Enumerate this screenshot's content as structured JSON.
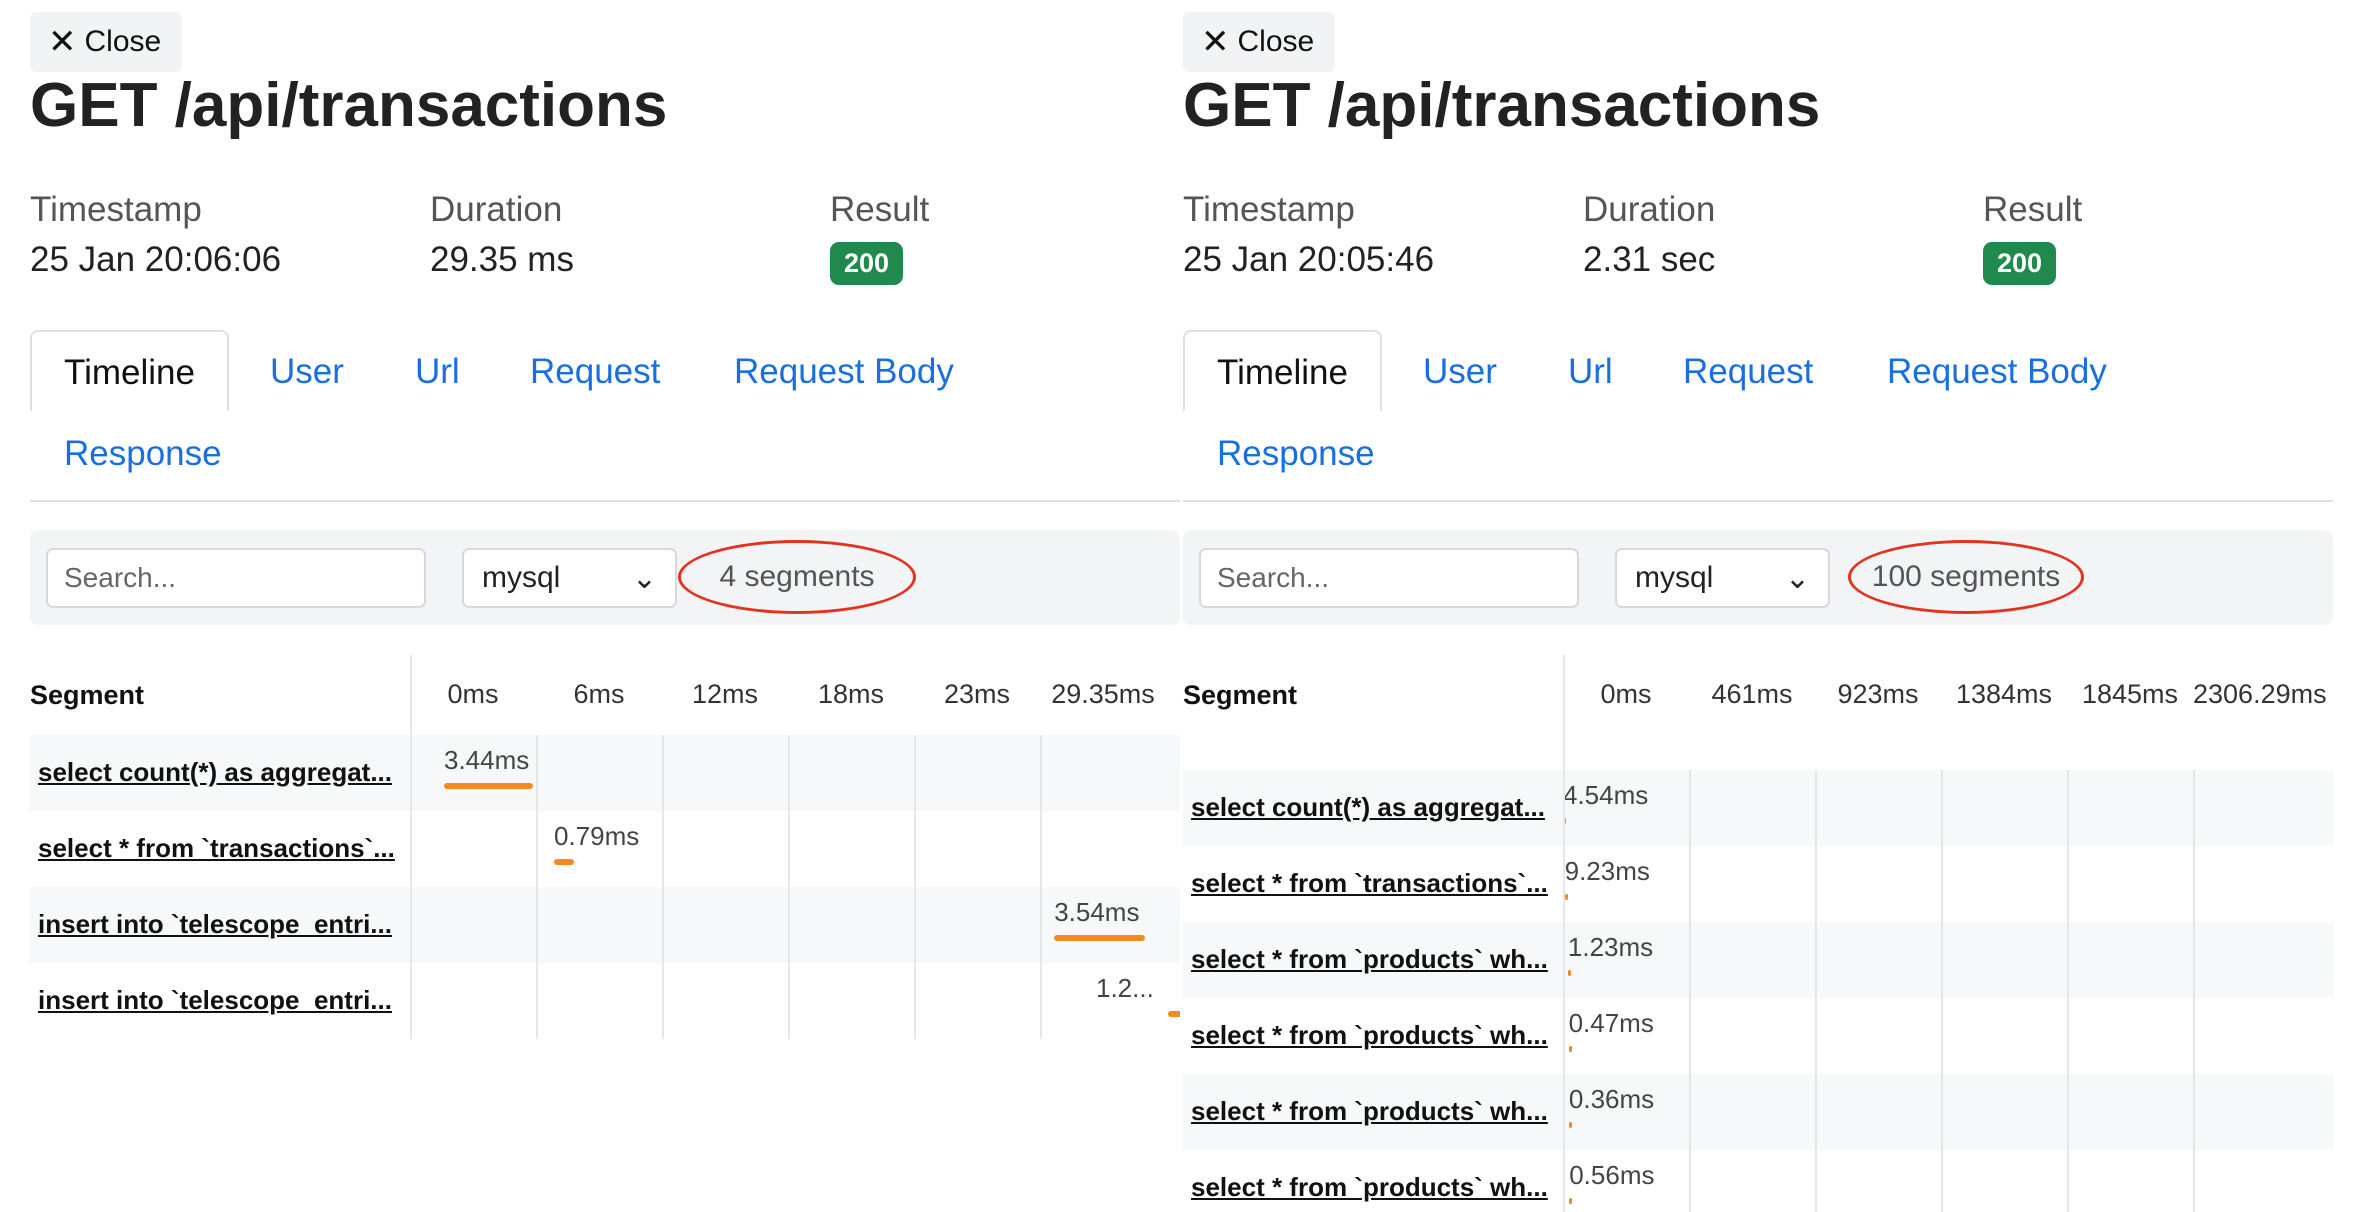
{
  "panels": [
    {
      "close_label": "Close",
      "title": "GET /api/transactions",
      "timestamp_label": "Timestamp",
      "timestamp_value": "25 Jan 20:06:06",
      "duration_label": "Duration",
      "duration_value": "29.35 ms",
      "result_label": "Result",
      "result_value": "200",
      "tabs": [
        "Timeline",
        "User",
        "Url",
        "Request",
        "Request Body",
        "Response"
      ],
      "search_placeholder": "Search...",
      "filter_value": "mysql",
      "segment_count": "4 segments",
      "segment_header": "Segment",
      "ticks": [
        "0ms",
        "6ms",
        "12ms",
        "18ms",
        "23ms",
        "29.35ms"
      ],
      "rows": [
        {
          "name": "select count(*) as aggregat...",
          "duration": "3.44ms",
          "start": 0.0,
          "dur": 3.44
        },
        {
          "name": "select * from `transactions`...",
          "duration": "0.79ms",
          "start": 4.27,
          "dur": 0.79
        },
        {
          "name": "insert into `telescope_entri...",
          "duration": "3.54ms",
          "start": 23.69,
          "dur": 3.54
        },
        {
          "name": "insert into `telescope_entri...",
          "duration": "1.2...",
          "start": 28.1,
          "dur": 1.25
        }
      ],
      "total_ms": 29.35
    },
    {
      "close_label": "Close",
      "title": "GET /api/transactions",
      "timestamp_label": "Timestamp",
      "timestamp_value": "25 Jan 20:05:46",
      "duration_label": "Duration",
      "duration_value": "2.31 sec",
      "result_label": "Result",
      "result_value": "200",
      "tabs": [
        "Timeline",
        "User",
        "Url",
        "Request",
        "Request Body",
        "Response"
      ],
      "search_placeholder": "Search...",
      "filter_value": "mysql",
      "segment_count": "100 segments",
      "segment_header": "Segment",
      "ticks": [
        "0ms",
        "461ms",
        "923ms",
        "1384ms",
        "1845ms",
        "2306.29ms"
      ],
      "rows": [
        {
          "name": "select count(*) as aggregat...",
          "duration": "4.54ms",
          "start": 0.0,
          "dur": 4.54
        },
        {
          "name": "select * from `transactions`...",
          "duration": "9.23ms",
          "start": 5.0,
          "dur": 9.23
        },
        {
          "name": "select * from `products` wh...",
          "duration": "1.23ms",
          "start": 15.0,
          "dur": 1.23
        },
        {
          "name": "select * from `products` wh...",
          "duration": "0.47ms",
          "start": 17.0,
          "dur": 0.47
        },
        {
          "name": "select * from `products` wh...",
          "duration": "0.36ms",
          "start": 18.0,
          "dur": 0.36
        },
        {
          "name": "select * from `products` wh...",
          "duration": "0.56ms",
          "start": 19.0,
          "dur": 0.56
        }
      ],
      "total_ms": 2306.29
    }
  ],
  "colors": {
    "accent_link": "#1a6fe0",
    "success_badge": "#1f8a4c",
    "bar": "#f48a1e",
    "annotation_oval": "#e3321d"
  },
  "icons": {
    "close": "close-icon",
    "dropdown": "chevron-down-icon"
  }
}
